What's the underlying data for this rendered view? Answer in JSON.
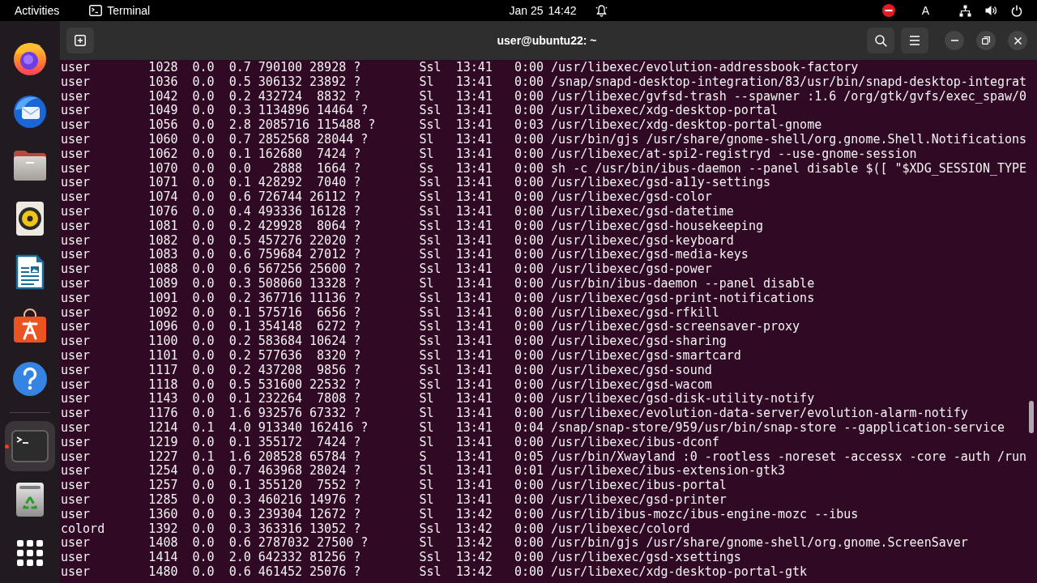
{
  "top_bar": {
    "activities": "Activities",
    "app_name": "Terminal",
    "date": "Jan 25",
    "time": "14:42",
    "input_source": "A"
  },
  "dock": {
    "favorites": [
      {
        "kind": "browser",
        "selected": false,
        "running": false
      },
      {
        "kind": "mail",
        "selected": false,
        "running": false
      },
      {
        "kind": "files",
        "selected": false,
        "running": false
      },
      {
        "kind": "music",
        "selected": false,
        "running": false
      },
      {
        "kind": "writer",
        "selected": false,
        "running": false
      },
      {
        "kind": "store",
        "selected": false,
        "running": false
      },
      {
        "kind": "help",
        "selected": false,
        "running": false
      }
    ],
    "others": [
      {
        "kind": "terminal",
        "selected": true,
        "running": true
      },
      {
        "kind": "trash",
        "selected": false,
        "running": false
      }
    ]
  },
  "header": {
    "title": "user@ubuntu22: ~"
  },
  "terminal": {
    "lines": [
      "user        1028  0.0  0.7 790100 28928 ?        Ssl  13:41   0:00 /usr/libexec/evolution-addressbook-factory",
      "user        1036  0.0  0.5 306132 23892 ?        Sl   13:41   0:00 /snap/snapd-desktop-integration/83/usr/bin/snapd-desktop-integrat",
      "user        1042  0.0  0.2 432724  8832 ?        Sl   13:41   0:00 /usr/libexec/gvfsd-trash --spawner :1.6 /org/gtk/gvfs/exec_spaw/0",
      "user        1049  0.0  0.3 1134896 14464 ?       Ssl  13:41   0:00 /usr/libexec/xdg-desktop-portal",
      "user        1056  0.0  2.8 2085716 115488 ?      Ssl  13:41   0:03 /usr/libexec/xdg-desktop-portal-gnome",
      "user        1060  0.0  0.7 2852568 28044 ?       Sl   13:41   0:00 /usr/bin/gjs /usr/share/gnome-shell/org.gnome.Shell.Notifications",
      "user        1062  0.0  0.1 162680  7424 ?        Sl   13:41   0:00 /usr/libexec/at-spi2-registryd --use-gnome-session",
      "user        1070  0.0  0.0   2888  1664 ?        Ss   13:41   0:00 sh -c /usr/bin/ibus-daemon --panel disable $([ \"$XDG_SESSION_TYPE",
      "user        1071  0.0  0.1 428292  7040 ?        Ssl  13:41   0:00 /usr/libexec/gsd-a11y-settings",
      "user        1074  0.0  0.6 726744 26112 ?        Ssl  13:41   0:00 /usr/libexec/gsd-color",
      "user        1076  0.0  0.4 493336 16128 ?        Ssl  13:41   0:00 /usr/libexec/gsd-datetime",
      "user        1081  0.0  0.2 429928  8064 ?        Ssl  13:41   0:00 /usr/libexec/gsd-housekeeping",
      "user        1082  0.0  0.5 457276 22020 ?        Ssl  13:41   0:00 /usr/libexec/gsd-keyboard",
      "user        1083  0.0  0.6 759684 27012 ?        Ssl  13:41   0:00 /usr/libexec/gsd-media-keys",
      "user        1088  0.0  0.6 567256 25600 ?        Ssl  13:41   0:00 /usr/libexec/gsd-power",
      "user        1089  0.0  0.3 508060 13328 ?        Sl   13:41   0:00 /usr/bin/ibus-daemon --panel disable",
      "user        1091  0.0  0.2 367716 11136 ?        Ssl  13:41   0:00 /usr/libexec/gsd-print-notifications",
      "user        1092  0.0  0.1 575716  6656 ?        Ssl  13:41   0:00 /usr/libexec/gsd-rfkill",
      "user        1096  0.0  0.1 354148  6272 ?        Ssl  13:41   0:00 /usr/libexec/gsd-screensaver-proxy",
      "user        1100  0.0  0.2 583684 10624 ?        Ssl  13:41   0:00 /usr/libexec/gsd-sharing",
      "user        1101  0.0  0.2 577636  8320 ?        Ssl  13:41   0:00 /usr/libexec/gsd-smartcard",
      "user        1117  0.0  0.2 437208  9856 ?        Ssl  13:41   0:00 /usr/libexec/gsd-sound",
      "user        1118  0.0  0.5 531600 22532 ?        Ssl  13:41   0:00 /usr/libexec/gsd-wacom",
      "user        1143  0.0  0.1 232264  7808 ?        Sl   13:41   0:00 /usr/libexec/gsd-disk-utility-notify",
      "user        1176  0.0  1.6 932576 67332 ?        Sl   13:41   0:00 /usr/libexec/evolution-data-server/evolution-alarm-notify",
      "user        1214  0.1  4.0 913340 162416 ?       Sl   13:41   0:04 /snap/snap-store/959/usr/bin/snap-store --gapplication-service",
      "user        1219  0.0  0.1 355172  7424 ?        Sl   13:41   0:00 /usr/libexec/ibus-dconf",
      "user        1227  0.1  1.6 208528 65784 ?        S    13:41   0:05 /usr/bin/Xwayland :0 -rootless -noreset -accessx -core -auth /run",
      "user        1254  0.0  0.7 463968 28024 ?        Sl   13:41   0:01 /usr/libexec/ibus-extension-gtk3",
      "user        1257  0.0  0.1 355120  7552 ?        Sl   13:41   0:00 /usr/libexec/ibus-portal",
      "user        1285  0.0  0.3 460216 14976 ?        Sl   13:41   0:00 /usr/libexec/gsd-printer",
      "user        1360  0.0  0.3 239304 12672 ?        Sl   13:42   0:00 /usr/lib/ibus-mozc/ibus-engine-mozc --ibus",
      "colord      1392  0.0  0.3 363316 13052 ?        Ssl  13:42   0:00 /usr/libexec/colord",
      "user        1408  0.0  0.6 2787032 27500 ?       Sl   13:42   0:00 /usr/bin/gjs /usr/share/gnome-shell/org.gnome.ScreenSaver",
      "user        1414  0.0  2.0 642332 81256 ?        Ssl  13:42   0:00 /usr/libexec/gsd-xsettings",
      "user        1480  0.0  0.6 461452 25076 ?        Ssl  13:42   0:00 /usr/libexec/xdg-desktop-portal-gtk"
    ]
  }
}
